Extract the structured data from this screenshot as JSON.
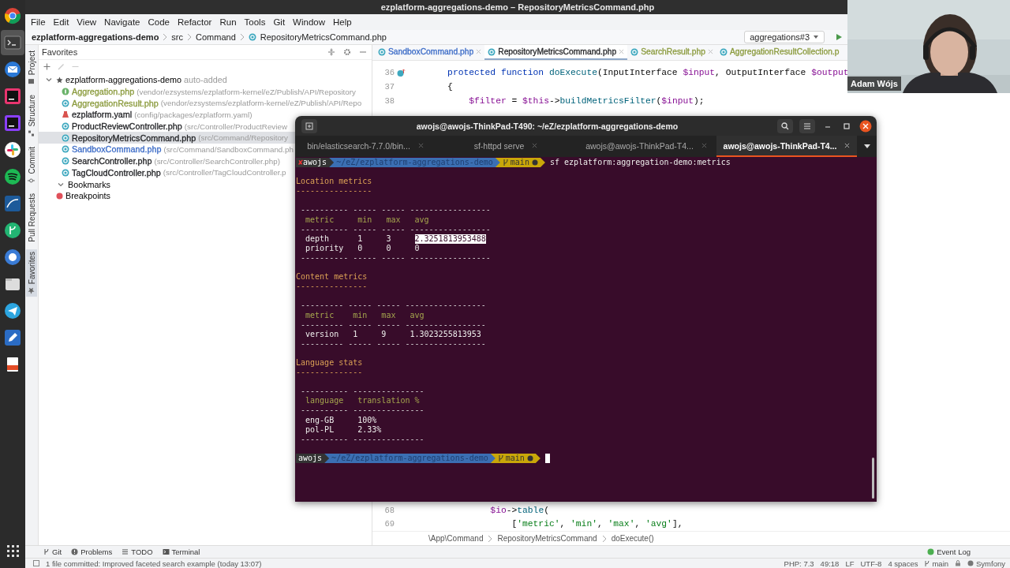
{
  "title_bar": {
    "title": "ezplatform-aggregations-demo – RepositoryMetricsCommand.php"
  },
  "dock": [
    {
      "kind": "browser",
      "selected": false
    },
    {
      "kind": "terminal",
      "selected": true
    },
    {
      "kind": "mail",
      "selected": false
    },
    {
      "kind": "ide-dark",
      "selected": false
    },
    {
      "kind": "ide-purple",
      "selected": false
    },
    {
      "kind": "chat",
      "selected": false
    },
    {
      "kind": "music",
      "selected": false
    },
    {
      "kind": "database",
      "selected": false
    },
    {
      "kind": "git",
      "selected": false
    },
    {
      "kind": "cloud",
      "selected": false
    },
    {
      "kind": "files",
      "selected": false
    },
    {
      "kind": "messenger",
      "selected": false
    },
    {
      "kind": "editor",
      "selected": false
    },
    {
      "kind": "office",
      "selected": false
    },
    {
      "kind": "apps",
      "selected": false
    }
  ],
  "menu": [
    "File",
    "Edit",
    "View",
    "Navigate",
    "Code",
    "Refactor",
    "Run",
    "Tools",
    "Git",
    "Window",
    "Help"
  ],
  "navigation": {
    "breadcrumbs": [
      "ezplatform-aggregations-demo",
      "src",
      "Command",
      "RepositoryMetricsCommand.php"
    ],
    "run_config": "aggregations#3"
  },
  "tool_strip": [
    {
      "label": "Project",
      "kind": "project",
      "selected": false
    },
    {
      "label": "Structure",
      "kind": "structure",
      "selected": false
    },
    {
      "label": "Commit",
      "kind": "commit",
      "selected": false
    },
    {
      "label": "Pull Requests",
      "kind": "pull-requests",
      "selected": false
    },
    {
      "label": "Favorites",
      "kind": "favorites",
      "selected": true
    }
  ],
  "favorites": {
    "title": "Favorites",
    "tree": [
      {
        "kind": "project",
        "label": "ezplatform-aggregations-demo",
        "note": "auto-added",
        "expanded": true,
        "children": [
          {
            "name": "Aggregation.php",
            "path": "(vendor/ezsystems/ezplatform-kernel/eZ/Publish/API/Repository",
            "kind": "interface",
            "color": "#8a9a3c",
            "selected": false
          },
          {
            "name": "AggregationResult.php",
            "path": "(vendor/ezsystems/ezplatform-kernel/eZ/Publish/API/Repo",
            "kind": "class",
            "color": "#8a9a3c",
            "selected": false
          },
          {
            "name": "ezplatform.yaml",
            "path": "(config/packages/ezplatform.yaml)",
            "kind": "yaml",
            "color": "#1e1f22",
            "selected": false
          },
          {
            "name": "ProductReviewController.php",
            "path": "(src/Controller/ProductReview",
            "kind": "class",
            "color": "#1e1f22",
            "selected": false
          },
          {
            "name": "RepositoryMetricsCommand.php",
            "path": "(src/Command/Repository",
            "kind": "class",
            "color": "#1e1f22",
            "selected": true
          },
          {
            "name": "SandboxCommand.php",
            "path": "(src/Command/SandboxCommand.ph",
            "kind": "class",
            "color": "#3b6bc7",
            "selected": false
          },
          {
            "name": "SearchController.php",
            "path": "(src/Controller/SearchController.php)",
            "kind": "class",
            "color": "#1e1f22",
            "selected": false
          },
          {
            "name": "TagCloudController.php",
            "path": "(src/Controller/TagCloudController.p",
            "kind": "class",
            "color": "#1e1f22",
            "selected": false
          }
        ]
      },
      {
        "kind": "bookmarks",
        "label": "Bookmarks",
        "expanded": true
      },
      {
        "kind": "breakpoints",
        "label": "Breakpoints"
      }
    ]
  },
  "editor": {
    "tabs": [
      {
        "label": "SandboxCommand.php",
        "color": "#3b6bc7",
        "selected": false
      },
      {
        "label": "RepositoryMetricsCommand.php",
        "color": "#1e1f22",
        "selected": true
      },
      {
        "label": "SearchResult.php",
        "color": "#8a9a3c",
        "selected": false
      },
      {
        "label": "AggregationResultCollection.p",
        "color": "#8a9a3c",
        "selected": false
      }
    ],
    "code_top": [
      {
        "number": "36",
        "override": true,
        "tokens": [
          {
            "kind": "keyword",
            "text": "    protected function "
          },
          {
            "kind": "function",
            "text": "doExecute"
          },
          {
            "kind": "plain",
            "text": "(InputInterface "
          },
          {
            "kind": "variable",
            "text": "$input"
          },
          {
            "kind": "plain",
            "text": ", OutputInterface "
          },
          {
            "kind": "variable",
            "text": "$output"
          }
        ]
      },
      {
        "number": "37",
        "tokens": [
          {
            "kind": "plain",
            "text": "    {"
          }
        ]
      },
      {
        "number": "38",
        "tokens": [
          {
            "kind": "variable",
            "text": "        $filter"
          },
          {
            "kind": "plain",
            "text": " = "
          },
          {
            "kind": "variable",
            "text": "$this"
          },
          {
            "kind": "plain",
            "text": "->"
          },
          {
            "kind": "function",
            "text": "buildMetricsFilter"
          },
          {
            "kind": "plain",
            "text": "("
          },
          {
            "kind": "variable",
            "text": "$input"
          },
          {
            "kind": "plain",
            "text": ");"
          }
        ]
      }
    ],
    "code_bottom": [
      {
        "number": "68",
        "tokens": [
          {
            "kind": "variable",
            "text": "            $io"
          },
          {
            "kind": "plain",
            "text": "->"
          },
          {
            "kind": "function",
            "text": "table"
          },
          {
            "kind": "plain",
            "text": "("
          }
        ]
      },
      {
        "number": "69",
        "tokens": [
          {
            "kind": "plain",
            "text": "                ["
          },
          {
            "kind": "string",
            "text": "'metric'"
          },
          {
            "kind": "plain",
            "text": ", "
          },
          {
            "kind": "string",
            "text": "'min'"
          },
          {
            "kind": "plain",
            "text": ", "
          },
          {
            "kind": "string",
            "text": "'max'"
          },
          {
            "kind": "plain",
            "text": ", "
          },
          {
            "kind": "string",
            "text": "'avg'"
          },
          {
            "kind": "plain",
            "text": "],"
          }
        ]
      }
    ],
    "breadcrumbs": [
      "\\App\\Command",
      "RepositoryMetricsCommand",
      "doExecute()"
    ]
  },
  "tool_windows": {
    "left": [
      {
        "label": "Git",
        "kind": "git"
      },
      {
        "label": "Problems",
        "kind": "problems"
      },
      {
        "label": "TODO",
        "kind": "todo"
      },
      {
        "label": "Terminal",
        "kind": "terminal"
      }
    ],
    "right": "Event Log"
  },
  "status_bar": {
    "message": "1 file committed: Improved faceted search example (today 13:07)",
    "items": [
      "PHP: 7.3",
      "49:18",
      "LF",
      "UTF-8",
      "4 spaces"
    ],
    "branch": "main",
    "framework": "Symfony"
  },
  "terminal": {
    "title": "awojs@awojs-ThinkPad-T490: ~/eZ/ezplatform-aggregations-demo",
    "tabs": [
      {
        "label": "bin/elasticsearch-7.7.0/bin...",
        "selected": false
      },
      {
        "label": "sf-httpd serve",
        "selected": false
      },
      {
        "label": "awojs@awojs-ThinkPad-T4...",
        "selected": false
      },
      {
        "label": "awojs@awojs-ThinkPad-T4...",
        "selected": true
      }
    ],
    "lines": [
      {
        "kind": "prompt",
        "status": "✘",
        "user": "awojs",
        "path": "~/eZ/ezplatform-aggregations-demo",
        "branch": "main",
        "dirty": true,
        "command": "sf ezplatform:aggregation-demo:metrics",
        "cursor": false
      },
      {
        "kind": "blank"
      },
      {
        "kind": "heading",
        "text": "Location metrics"
      },
      {
        "kind": "underline",
        "text": "----------------"
      },
      {
        "kind": "blank"
      },
      {
        "kind": "rule",
        "text": "---------- ----- ----- -----------------"
      },
      {
        "kind": "header",
        "text": "metric     min   max   avg"
      },
      {
        "kind": "rule",
        "text": "---------- ----- ----- -----------------"
      },
      {
        "kind": "row",
        "segments": [
          {
            "text": "depth      1     3     ",
            "selected": false
          },
          {
            "text": "2.3251813953488",
            "selected": true
          }
        ]
      },
      {
        "kind": "row",
        "text": "priority   0     0     0"
      },
      {
        "kind": "rule",
        "text": "---------- ----- ----- -----------------"
      },
      {
        "kind": "blank"
      },
      {
        "kind": "heading",
        "text": "Content metrics"
      },
      {
        "kind": "underline",
        "text": "---------------"
      },
      {
        "kind": "blank"
      },
      {
        "kind": "rule",
        "text": "--------- ----- ----- -----------------"
      },
      {
        "kind": "header",
        "text": "metric    min   max   avg"
      },
      {
        "kind": "rule",
        "text": "--------- ----- ----- -----------------"
      },
      {
        "kind": "row",
        "text": "version   1     9     1.3023255813953"
      },
      {
        "kind": "rule",
        "text": "--------- ----- ----- -----------------"
      },
      {
        "kind": "blank"
      },
      {
        "kind": "heading",
        "text": "Language stats"
      },
      {
        "kind": "underline",
        "text": "--------------"
      },
      {
        "kind": "blank"
      },
      {
        "kind": "rule",
        "text": "---------- ---------------"
      },
      {
        "kind": "header",
        "text": "language   translation %"
      },
      {
        "kind": "rule",
        "text": "---------- ---------------"
      },
      {
        "kind": "row",
        "text": "eng-GB     100%"
      },
      {
        "kind": "row",
        "text": "pol-PL     2.33%"
      },
      {
        "kind": "rule",
        "text": "---------- ---------------"
      },
      {
        "kind": "blank"
      },
      {
        "kind": "prompt",
        "user": "awojs",
        "path": "~/eZ/ezplatform-aggregations-demo",
        "branch": "main",
        "dirty": true,
        "cursor": true
      }
    ]
  },
  "webcam": {
    "kind": "picture",
    "name": "Adam Wójs"
  }
}
